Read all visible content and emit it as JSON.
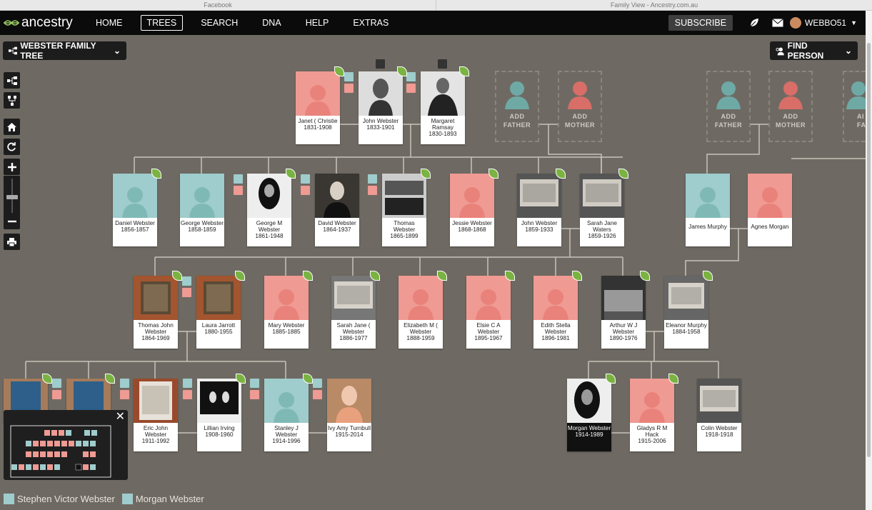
{
  "browser": {
    "tabs": [
      "Facebook",
      "Family View - Ancestry.com.au"
    ]
  },
  "nav": {
    "brand": "ancestry",
    "items": [
      {
        "label": "HOME",
        "active": false
      },
      {
        "label": "TREES",
        "active": true
      },
      {
        "label": "SEARCH",
        "active": false
      },
      {
        "label": "DNA",
        "active": false
      },
      {
        "label": "HELP",
        "active": false
      },
      {
        "label": "EXTRAS",
        "active": false
      }
    ],
    "subscribe": "SUBSCRIBE",
    "username": "WEBBO51"
  },
  "tree_selector": "WEBSTER FAMILY TREE",
  "find_person": "FIND PERSON",
  "add_father": [
    "ADD",
    "FATHER"
  ],
  "add_mother": [
    "ADD",
    "MOTHER"
  ],
  "add_partial": "AI",
  "add_partial2": "FAT",
  "people": {
    "janet": {
      "name": "Janet ( Christie",
      "dates": "1831-1908"
    },
    "john_sr": {
      "name": "John Webster",
      "dates": "1833-1901"
    },
    "margaret": {
      "name": "Margaret Ramsay",
      "dates": "1830-1893"
    },
    "daniel": {
      "name": "Daniel Webster",
      "dates": "1856-1857"
    },
    "george": {
      "name": "George Webster",
      "dates": "1858-1859"
    },
    "george_m": {
      "name": "George M Webster",
      "dates": "1861-1948"
    },
    "david": {
      "name": "David Webster",
      "dates": "1864-1937"
    },
    "thomas": {
      "name": "Thomas Webster",
      "dates": "1865-1899"
    },
    "jessie": {
      "name": "Jessie Webster",
      "dates": "1868-1868"
    },
    "john": {
      "name": "John Webster",
      "dates": "1859-1933"
    },
    "sarah_jane": {
      "name": "Sarah Jane Waters",
      "dates": "1859-1926"
    },
    "james": {
      "name": "James Murphy",
      "dates": ""
    },
    "agnes": {
      "name": "Agnes Morgan",
      "dates": ""
    },
    "thomas_john": {
      "name": "Thomas John Webster",
      "dates": "1864-1969"
    },
    "laura": {
      "name": "Laura Jarrott",
      "dates": "1880-1955"
    },
    "mary": {
      "name": "Mary Webster",
      "dates": "1885-1885"
    },
    "sarah_jane2": {
      "name": "Sarah Jane ( Webster",
      "dates": "1886-1977"
    },
    "elizabeth": {
      "name": "Elizabeth M ( Webster",
      "dates": "1888-1959"
    },
    "elsie": {
      "name": "Elsie C A Webster",
      "dates": "1895-1967"
    },
    "edith": {
      "name": "Edith Stella Webster",
      "dates": "1896-1981"
    },
    "arthur": {
      "name": "Arthur W J Webster",
      "dates": "1890-1976"
    },
    "eleanor": {
      "name": "Eleanor Murphy",
      "dates": "1884-1958"
    },
    "eric": {
      "name": "Eric John Webster",
      "dates": "1911-1992"
    },
    "lillian": {
      "name": "Lillian Irving",
      "dates": "1908-1960"
    },
    "stanley": {
      "name": "Stanley J Webster",
      "dates": "1914-1996"
    },
    "ivy": {
      "name": "Ivy Amy Turnbull",
      "dates": "1915-2014"
    },
    "morgan": {
      "name": "Morgan Webster",
      "dates": "1914-1989"
    },
    "gladys": {
      "name": "Gladys R M Hack",
      "dates": "1915-2006"
    },
    "colin": {
      "name": "Colin Webster",
      "dates": "1918-1918"
    }
  },
  "footer": [
    {
      "label": "Stephen Victor Webster",
      "color": "#9fcccc"
    },
    {
      "label": "Morgan Webster",
      "color": "#9fcccc"
    }
  ],
  "colors": {
    "male": "#9fcccc",
    "female": "#ef9a93",
    "leaf": "#7bb342"
  }
}
